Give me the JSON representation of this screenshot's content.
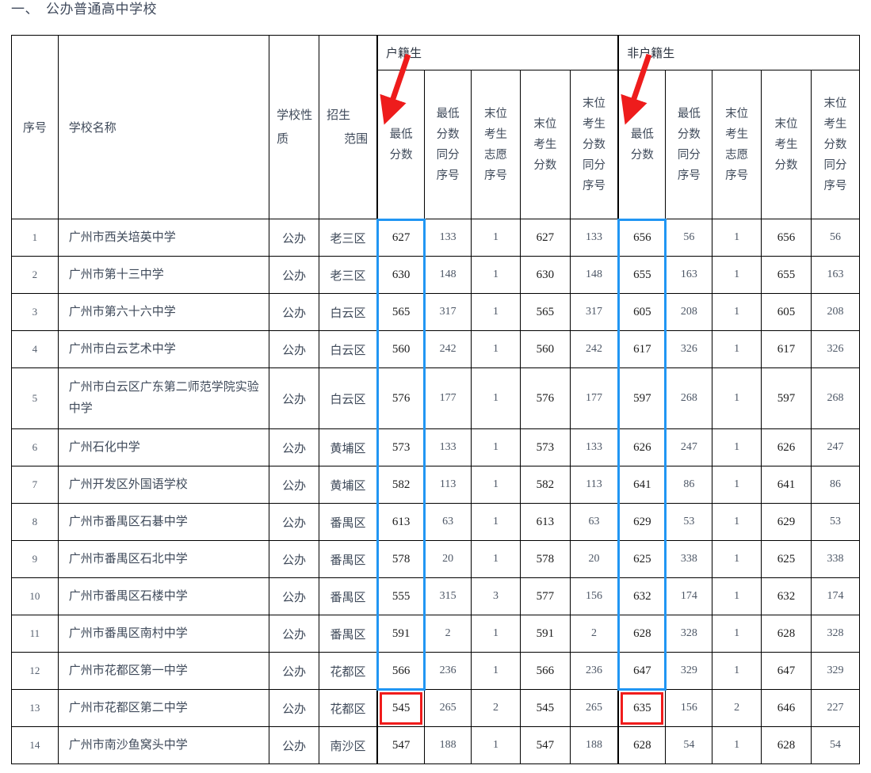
{
  "title": {
    "num": "一、",
    "text": "公办普通高中学校"
  },
  "table": {
    "column_headers": {
      "seq": "序号",
      "school_name": "学校名称",
      "school_type_l1": "学校性",
      "school_type_l2": "质",
      "enroll_range_l1": "招生",
      "enroll_range_l2": "范围"
    },
    "group_headers": [
      {
        "label": "户籍生"
      },
      {
        "label": "非户籍生"
      }
    ],
    "sub_headers": [
      "最低\n分数",
      "最低\n分数\n同分\n序号",
      "末位\n考生\n志愿\n序号",
      "末位\n考生\n分数",
      "末位\n考生\n分数\n同分\n序号"
    ],
    "sub_header_lines": {
      "min_score": [
        "最低",
        "分数"
      ],
      "min_score_rank": [
        "最低",
        "分数",
        "同分",
        "序号"
      ],
      "last_wish_rank": [
        "末位",
        "考生",
        "志愿",
        "序号"
      ],
      "last_score": [
        "末位",
        "考生",
        "分数"
      ],
      "last_score_rank": [
        "末位",
        "考生",
        "分数",
        "同分",
        "序号"
      ]
    },
    "rows": [
      {
        "seq": "1",
        "name": "广州市西关培英中学",
        "type": "公办",
        "range": "老三区",
        "h_min": "627",
        "h_minrank": "133",
        "h_wish": "1",
        "h_last": "627",
        "h_lastrank": "133",
        "n_min": "656",
        "n_minrank": "56",
        "n_wish": "1",
        "n_last": "656",
        "n_lastrank": "56",
        "tall": false
      },
      {
        "seq": "2",
        "name": "广州市第十三中学",
        "type": "公办",
        "range": "老三区",
        "h_min": "630",
        "h_minrank": "148",
        "h_wish": "1",
        "h_last": "630",
        "h_lastrank": "148",
        "n_min": "655",
        "n_minrank": "163",
        "n_wish": "1",
        "n_last": "655",
        "n_lastrank": "163",
        "tall": false
      },
      {
        "seq": "3",
        "name": "广州市第六十六中学",
        "type": "公办",
        "range": "白云区",
        "h_min": "565",
        "h_minrank": "317",
        "h_wish": "1",
        "h_last": "565",
        "h_lastrank": "317",
        "n_min": "605",
        "n_minrank": "208",
        "n_wish": "1",
        "n_last": "605",
        "n_lastrank": "208",
        "tall": false
      },
      {
        "seq": "4",
        "name": "广州市白云艺术中学",
        "type": "公办",
        "range": "白云区",
        "h_min": "560",
        "h_minrank": "242",
        "h_wish": "1",
        "h_last": "560",
        "h_lastrank": "242",
        "n_min": "617",
        "n_minrank": "326",
        "n_wish": "1",
        "n_last": "617",
        "n_lastrank": "326",
        "tall": false
      },
      {
        "seq": "5",
        "name": "广州市白云区广东第二师范学院实验中学",
        "type": "公办",
        "range": "白云区",
        "h_min": "576",
        "h_minrank": "177",
        "h_wish": "1",
        "h_last": "576",
        "h_lastrank": "177",
        "n_min": "597",
        "n_minrank": "268",
        "n_wish": "1",
        "n_last": "597",
        "n_lastrank": "268",
        "tall": true
      },
      {
        "seq": "6",
        "name": "广州石化中学",
        "type": "公办",
        "range": "黄埔区",
        "h_min": "573",
        "h_minrank": "133",
        "h_wish": "1",
        "h_last": "573",
        "h_lastrank": "133",
        "n_min": "626",
        "n_minrank": "247",
        "n_wish": "1",
        "n_last": "626",
        "n_lastrank": "247",
        "tall": false
      },
      {
        "seq": "7",
        "name": "广州开发区外国语学校",
        "type": "公办",
        "range": "黄埔区",
        "h_min": "582",
        "h_minrank": "113",
        "h_wish": "1",
        "h_last": "582",
        "h_lastrank": "113",
        "n_min": "641",
        "n_minrank": "86",
        "n_wish": "1",
        "n_last": "641",
        "n_lastrank": "86",
        "tall": false
      },
      {
        "seq": "8",
        "name": "广州市番禺区石碁中学",
        "type": "公办",
        "range": "番禺区",
        "h_min": "613",
        "h_minrank": "63",
        "h_wish": "1",
        "h_last": "613",
        "h_lastrank": "63",
        "n_min": "629",
        "n_minrank": "53",
        "n_wish": "1",
        "n_last": "629",
        "n_lastrank": "53",
        "tall": false
      },
      {
        "seq": "9",
        "name": "广州市番禺区石北中学",
        "type": "公办",
        "range": "番禺区",
        "h_min": "578",
        "h_minrank": "20",
        "h_wish": "1",
        "h_last": "578",
        "h_lastrank": "20",
        "n_min": "625",
        "n_minrank": "338",
        "n_wish": "1",
        "n_last": "625",
        "n_lastrank": "338",
        "tall": false
      },
      {
        "seq": "10",
        "name": "广州市番禺区石楼中学",
        "type": "公办",
        "range": "番禺区",
        "h_min": "555",
        "h_minrank": "315",
        "h_wish": "3",
        "h_last": "577",
        "h_lastrank": "156",
        "n_min": "632",
        "n_minrank": "174",
        "n_wish": "1",
        "n_last": "632",
        "n_lastrank": "174",
        "tall": false
      },
      {
        "seq": "11",
        "name": "广州市番禺区南村中学",
        "type": "公办",
        "range": "番禺区",
        "h_min": "591",
        "h_minrank": "2",
        "h_wish": "1",
        "h_last": "591",
        "h_lastrank": "2",
        "n_min": "628",
        "n_minrank": "328",
        "n_wish": "1",
        "n_last": "628",
        "n_lastrank": "328",
        "tall": false
      },
      {
        "seq": "12",
        "name": "广州市花都区第一中学",
        "type": "公办",
        "range": "花都区",
        "h_min": "566",
        "h_minrank": "236",
        "h_wish": "1",
        "h_last": "566",
        "h_lastrank": "236",
        "n_min": "647",
        "n_minrank": "329",
        "n_wish": "1",
        "n_last": "647",
        "n_lastrank": "329",
        "tall": false
      },
      {
        "seq": "13",
        "name": "广州市花都区第二中学",
        "type": "公办",
        "range": "花都区",
        "h_min": "545",
        "h_minrank": "265",
        "h_wish": "2",
        "h_last": "545",
        "h_lastrank": "265",
        "n_min": "635",
        "n_minrank": "156",
        "n_wish": "2",
        "n_last": "646",
        "n_lastrank": "227",
        "tall": false
      },
      {
        "seq": "14",
        "name": "广州市南沙鱼窝头中学",
        "type": "公办",
        "range": "南沙区",
        "h_min": "547",
        "h_minrank": "188",
        "h_wish": "1",
        "h_last": "547",
        "h_lastrank": "188",
        "n_min": "628",
        "n_minrank": "54",
        "n_wish": "1",
        "n_last": "628",
        "n_lastrank": "54",
        "tall": false
      }
    ]
  },
  "annotations": {
    "highlight_blue_color": "#2196f3",
    "highlight_red_color": "#f01c1c",
    "arrow_color": "#ee1c1c",
    "blue_boxes": [
      {
        "label": "户籍生最低分数列-1至12行"
      },
      {
        "label": "非户籍生最低分数列-1至12行"
      }
    ],
    "red_boxes": [
      {
        "label": "户籍生最低分数-第13行-545"
      },
      {
        "label": "非户籍生最低分数-第13行-635"
      }
    ],
    "arrows": [
      {
        "label": "arrow-to-户籍生最低分数"
      },
      {
        "label": "arrow-to-非户籍生最低分数"
      }
    ]
  }
}
